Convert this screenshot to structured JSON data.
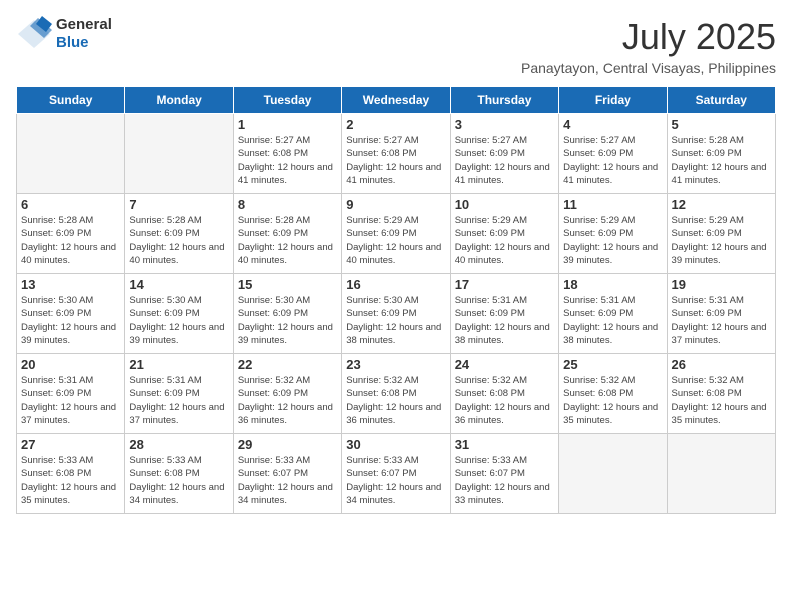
{
  "header": {
    "logo_general": "General",
    "logo_blue": "Blue",
    "month_year": "July 2025",
    "location": "Panaytayon, Central Visayas, Philippines"
  },
  "weekdays": [
    "Sunday",
    "Monday",
    "Tuesday",
    "Wednesday",
    "Thursday",
    "Friday",
    "Saturday"
  ],
  "weeks": [
    [
      {
        "day": "",
        "info": ""
      },
      {
        "day": "",
        "info": ""
      },
      {
        "day": "1",
        "info": "Sunrise: 5:27 AM\nSunset: 6:08 PM\nDaylight: 12 hours and 41 minutes."
      },
      {
        "day": "2",
        "info": "Sunrise: 5:27 AM\nSunset: 6:08 PM\nDaylight: 12 hours and 41 minutes."
      },
      {
        "day": "3",
        "info": "Sunrise: 5:27 AM\nSunset: 6:09 PM\nDaylight: 12 hours and 41 minutes."
      },
      {
        "day": "4",
        "info": "Sunrise: 5:27 AM\nSunset: 6:09 PM\nDaylight: 12 hours and 41 minutes."
      },
      {
        "day": "5",
        "info": "Sunrise: 5:28 AM\nSunset: 6:09 PM\nDaylight: 12 hours and 41 minutes."
      }
    ],
    [
      {
        "day": "6",
        "info": "Sunrise: 5:28 AM\nSunset: 6:09 PM\nDaylight: 12 hours and 40 minutes."
      },
      {
        "day": "7",
        "info": "Sunrise: 5:28 AM\nSunset: 6:09 PM\nDaylight: 12 hours and 40 minutes."
      },
      {
        "day": "8",
        "info": "Sunrise: 5:28 AM\nSunset: 6:09 PM\nDaylight: 12 hours and 40 minutes."
      },
      {
        "day": "9",
        "info": "Sunrise: 5:29 AM\nSunset: 6:09 PM\nDaylight: 12 hours and 40 minutes."
      },
      {
        "day": "10",
        "info": "Sunrise: 5:29 AM\nSunset: 6:09 PM\nDaylight: 12 hours and 40 minutes."
      },
      {
        "day": "11",
        "info": "Sunrise: 5:29 AM\nSunset: 6:09 PM\nDaylight: 12 hours and 39 minutes."
      },
      {
        "day": "12",
        "info": "Sunrise: 5:29 AM\nSunset: 6:09 PM\nDaylight: 12 hours and 39 minutes."
      }
    ],
    [
      {
        "day": "13",
        "info": "Sunrise: 5:30 AM\nSunset: 6:09 PM\nDaylight: 12 hours and 39 minutes."
      },
      {
        "day": "14",
        "info": "Sunrise: 5:30 AM\nSunset: 6:09 PM\nDaylight: 12 hours and 39 minutes."
      },
      {
        "day": "15",
        "info": "Sunrise: 5:30 AM\nSunset: 6:09 PM\nDaylight: 12 hours and 39 minutes."
      },
      {
        "day": "16",
        "info": "Sunrise: 5:30 AM\nSunset: 6:09 PM\nDaylight: 12 hours and 38 minutes."
      },
      {
        "day": "17",
        "info": "Sunrise: 5:31 AM\nSunset: 6:09 PM\nDaylight: 12 hours and 38 minutes."
      },
      {
        "day": "18",
        "info": "Sunrise: 5:31 AM\nSunset: 6:09 PM\nDaylight: 12 hours and 38 minutes."
      },
      {
        "day": "19",
        "info": "Sunrise: 5:31 AM\nSunset: 6:09 PM\nDaylight: 12 hours and 37 minutes."
      }
    ],
    [
      {
        "day": "20",
        "info": "Sunrise: 5:31 AM\nSunset: 6:09 PM\nDaylight: 12 hours and 37 minutes."
      },
      {
        "day": "21",
        "info": "Sunrise: 5:31 AM\nSunset: 6:09 PM\nDaylight: 12 hours and 37 minutes."
      },
      {
        "day": "22",
        "info": "Sunrise: 5:32 AM\nSunset: 6:09 PM\nDaylight: 12 hours and 36 minutes."
      },
      {
        "day": "23",
        "info": "Sunrise: 5:32 AM\nSunset: 6:08 PM\nDaylight: 12 hours and 36 minutes."
      },
      {
        "day": "24",
        "info": "Sunrise: 5:32 AM\nSunset: 6:08 PM\nDaylight: 12 hours and 36 minutes."
      },
      {
        "day": "25",
        "info": "Sunrise: 5:32 AM\nSunset: 6:08 PM\nDaylight: 12 hours and 35 minutes."
      },
      {
        "day": "26",
        "info": "Sunrise: 5:32 AM\nSunset: 6:08 PM\nDaylight: 12 hours and 35 minutes."
      }
    ],
    [
      {
        "day": "27",
        "info": "Sunrise: 5:33 AM\nSunset: 6:08 PM\nDaylight: 12 hours and 35 minutes."
      },
      {
        "day": "28",
        "info": "Sunrise: 5:33 AM\nSunset: 6:08 PM\nDaylight: 12 hours and 34 minutes."
      },
      {
        "day": "29",
        "info": "Sunrise: 5:33 AM\nSunset: 6:07 PM\nDaylight: 12 hours and 34 minutes."
      },
      {
        "day": "30",
        "info": "Sunrise: 5:33 AM\nSunset: 6:07 PM\nDaylight: 12 hours and 34 minutes."
      },
      {
        "day": "31",
        "info": "Sunrise: 5:33 AM\nSunset: 6:07 PM\nDaylight: 12 hours and 33 minutes."
      },
      {
        "day": "",
        "info": ""
      },
      {
        "day": "",
        "info": ""
      }
    ]
  ]
}
